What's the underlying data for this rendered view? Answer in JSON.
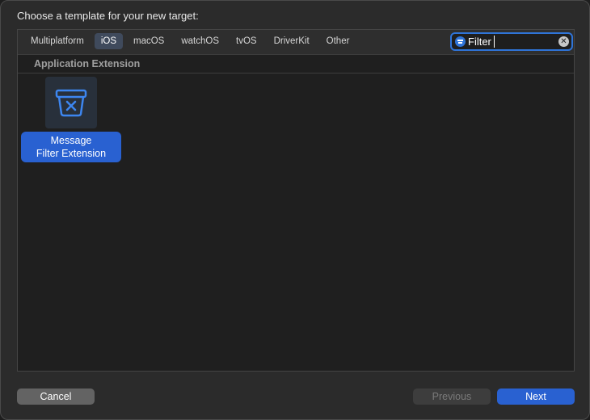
{
  "dialog": {
    "title": "Choose a template for your new target:"
  },
  "platform_tabs": [
    {
      "label": "Multiplatform",
      "selected": false
    },
    {
      "label": "iOS",
      "selected": true
    },
    {
      "label": "macOS",
      "selected": false
    },
    {
      "label": "watchOS",
      "selected": false
    },
    {
      "label": "tvOS",
      "selected": false
    },
    {
      "label": "DriverKit",
      "selected": false
    },
    {
      "label": "Other",
      "selected": false
    }
  ],
  "search": {
    "value": "Filter",
    "icon": "filter-icon",
    "clear_icon": "clear-icon"
  },
  "section": {
    "title": "Application Extension"
  },
  "templates": [
    {
      "name_line1": "Message",
      "name_line2": "Filter Extension",
      "icon": "message-filter-icon",
      "selected": true
    }
  ],
  "buttons": {
    "cancel": "Cancel",
    "previous": "Previous",
    "next": "Next"
  },
  "colors": {
    "accent": "#2961d1",
    "focus_ring": "#2f74d8",
    "selected_tab": "#3f4a5c"
  }
}
